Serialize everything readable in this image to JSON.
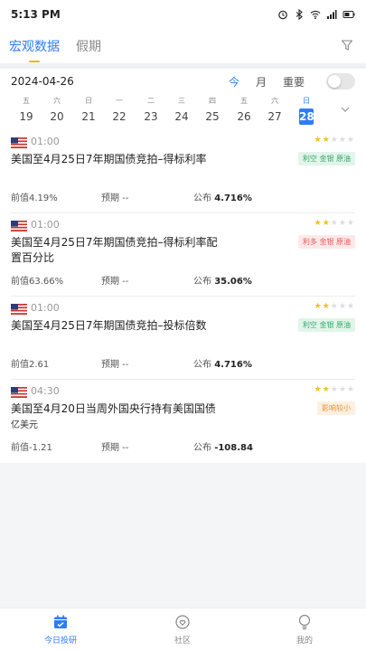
{
  "status_bar": {
    "time": "5:13 PM"
  },
  "tabs": [
    {
      "label": "宏观数据",
      "active": true
    },
    {
      "label": "假期",
      "active": false
    }
  ],
  "calendar": {
    "date": "2024-04-26",
    "views": [
      "今",
      "月",
      "重要"
    ],
    "active_view": "今",
    "days": [
      {
        "dow": "五",
        "num": "19"
      },
      {
        "dow": "六",
        "num": "20"
      },
      {
        "dow": "日",
        "num": "21"
      },
      {
        "dow": "一",
        "num": "22"
      },
      {
        "dow": "二",
        "num": "23"
      },
      {
        "dow": "三",
        "num": "24"
      },
      {
        "dow": "四",
        "num": "25"
      },
      {
        "dow": "五",
        "num": "26"
      },
      {
        "dow": "六",
        "num": "27"
      },
      {
        "dow": "日",
        "num": "28",
        "selected": true
      }
    ]
  },
  "items": [
    {
      "time": "01:00",
      "stars": 2,
      "title": "美国至4月25日7年期国债竞拍–得标利率",
      "unit": "",
      "tag": "利空 金银 原油",
      "tag_color": "#3aa56a",
      "prev": "前值4.19%",
      "expected_label": "预期 --",
      "actual_label": "公布",
      "actual": "4.716%"
    },
    {
      "time": "01:00",
      "stars": 2,
      "title": "美国至4月25日7年期国债竞拍–得标利率配置百分比",
      "unit": "",
      "tag": "利多 金银 原油",
      "tag_color": "#e05b5b",
      "prev": "前值63.66%",
      "expected_label": "预期 --",
      "actual_label": "公布",
      "actual": "35.06%"
    },
    {
      "time": "01:00",
      "stars": 2,
      "title": "美国至4月25日7年期国债竞拍–投标倍数",
      "unit": "",
      "tag": "利空 金银 原油",
      "tag_color": "#3aa56a",
      "prev": "前值2.61",
      "expected_label": "预期 --",
      "actual_label": "公布",
      "actual": "4.716%"
    },
    {
      "time": "04:30",
      "stars": 2,
      "title": "美国至4月20日当周外国央行持有美国国债",
      "unit": "亿美元",
      "tag": "影响较小",
      "tag_color": "#e8923a",
      "prev": "前值-1.21",
      "expected_label": "预期 --",
      "actual_label": "公布",
      "actual": "-108.84"
    }
  ],
  "bottom_nav": [
    {
      "label": "今日投研",
      "icon": "calendar-check-icon",
      "active": true
    },
    {
      "label": "社区",
      "icon": "heart-chat-icon",
      "active": false
    },
    {
      "label": "我的",
      "icon": "user-icon",
      "active": false
    }
  ],
  "colors": {
    "accent": "#2d7cf6",
    "star": "#f5c018"
  }
}
